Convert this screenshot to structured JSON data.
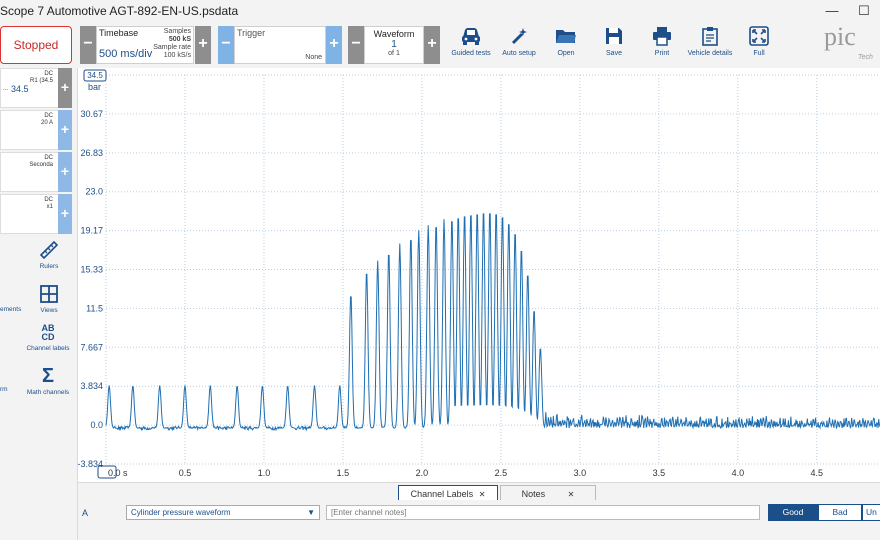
{
  "window": {
    "title": "Scope 7 Automotive AGT-892-EN-US.psdata"
  },
  "toolbar": {
    "status_label": "Stopped",
    "timebase": {
      "label": "Timebase",
      "value": "500 ms/div",
      "samples_label": "Samples",
      "samples_value": "500 kS",
      "rate_label": "Sample rate",
      "rate_value": "100 kS/s"
    },
    "trigger": {
      "label": "Trigger",
      "mode": "None"
    },
    "waveform": {
      "label": "Waveform",
      "current": "1",
      "of": "of 1"
    },
    "buttons": [
      {
        "label": "Guided tests",
        "icon": "car-icon"
      },
      {
        "label": "Auto setup",
        "icon": "wand-icon"
      },
      {
        "label": "Open",
        "icon": "folder-icon"
      },
      {
        "label": "Save",
        "icon": "save-icon"
      },
      {
        "label": "Print",
        "icon": "print-icon"
      },
      {
        "label": "Vehicle details",
        "icon": "clipboard-icon"
      },
      {
        "label": "Full",
        "icon": "fullscreen-icon"
      }
    ],
    "brand": "pic",
    "brand_sub": "Tech"
  },
  "channels": [
    {
      "coupling": "DC",
      "info": "R1 (34.5",
      "range": "34.5",
      "prefix": "..."
    },
    {
      "coupling": "DC",
      "info": "20 A",
      "range": "",
      "prefix": ""
    },
    {
      "coupling": "DC",
      "info": "Seconda",
      "range": "",
      "prefix": ""
    },
    {
      "coupling": "DC",
      "info": "x1",
      "range": "",
      "prefix": ""
    }
  ],
  "tools": [
    {
      "label": "Rulers",
      "icon": "ruler-icon"
    },
    {
      "label": "ements",
      "icon": ""
    },
    {
      "label": "Views",
      "icon": "views-icon"
    },
    {
      "label": "Channel labels",
      "icon": "channel-labels-icon",
      "glyph": "AB CD"
    },
    {
      "label": "Math channels",
      "icon": "sigma-icon",
      "glyph": "Σ"
    },
    {
      "label": "rm",
      "icon": ""
    }
  ],
  "chart_data": {
    "type": "line",
    "xlabel": "",
    "ylabel": "bar",
    "x_unit": "s",
    "xlim": [
      0,
      4.9
    ],
    "ylim": [
      -3.834,
      34.5
    ],
    "x_ticks": [
      "0.0 s",
      "0.5",
      "1.0",
      "1.5",
      "2.0",
      "2.5",
      "3.0",
      "3.5",
      "4.0",
      "4.5"
    ],
    "y_ticks": [
      "34.5",
      "30.67",
      "26.83",
      "23.0",
      "19.17",
      "15.33",
      "11.5",
      "7.667",
      "3.834",
      "0.0",
      "-3.834"
    ],
    "grid": true,
    "color": "#1f6fb2",
    "series": [
      {
        "name": "",
        "peaks_x": [
          0.02,
          0.17,
          0.34,
          0.5,
          0.66,
          0.83,
          0.99,
          1.15,
          1.32,
          1.48,
          1.55,
          1.65,
          1.72,
          1.79,
          1.86,
          1.93,
          1.98,
          2.04,
          2.09,
          2.14,
          2.19,
          2.23,
          2.27,
          2.31,
          2.35,
          2.39,
          2.43,
          2.47,
          2.51,
          2.55,
          2.59,
          2.63,
          2.67,
          2.71,
          2.75
        ],
        "peaks_y": [
          3.9,
          3.9,
          3.9,
          3.9,
          3.9,
          3.9,
          3.9,
          3.9,
          3.9,
          3.9,
          13.0,
          15.3,
          16.2,
          17.2,
          17.9,
          18.7,
          19.2,
          19.7,
          20.0,
          20.3,
          20.6,
          20.9,
          21.1,
          21.2,
          21.3,
          21.4,
          21.4,
          21.3,
          21.0,
          20.3,
          19.3,
          17.6,
          15.1,
          11.5,
          7.7
        ],
        "baseline": -0.3,
        "noise_start": 2.5,
        "noise_amplitude": 1.8
      }
    ]
  },
  "tabs": [
    {
      "label": "Channel Labels",
      "active": true
    },
    {
      "label": "Notes",
      "active": false
    }
  ],
  "notes": {
    "channel": "A",
    "label_value": "Cylinder pressure waveform",
    "notes_placeholder": "[Enter channel notes]",
    "quality": [
      "Good",
      "Bad",
      "Un"
    ]
  }
}
